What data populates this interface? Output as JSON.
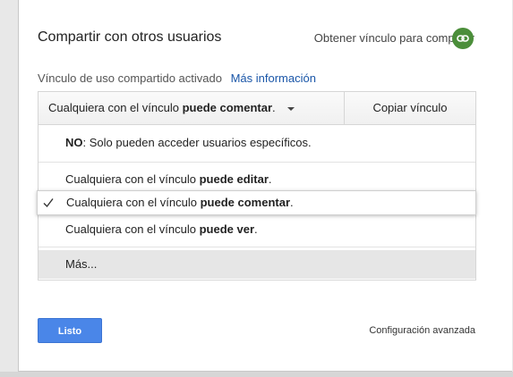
{
  "dialog": {
    "title": "Compartir con otros usuarios",
    "get_link_label": "Obtener vínculo para compartir",
    "get_link_icon": "link-icon",
    "status_text": "Vínculo de uso compartido activado",
    "more_info_label": "Más información",
    "colors": {
      "accent": "#4a86e8",
      "link": "#1a56a8",
      "link_icon_bg": "#4b8e3a"
    }
  },
  "access": {
    "trigger_prefix": "Cualquiera con el vínculo",
    "trigger_bold": "puede comentar",
    "trigger_suffix": ".",
    "copy_label": "Copiar vínculo",
    "options": [
      {
        "bold": "NO",
        "rest": ": Solo pueden acceder usuarios específicos."
      },
      {
        "prefix": "Cualquiera con el vínculo ",
        "bold": "puede editar",
        "suffix": "."
      },
      {
        "prefix": "Cualquiera con el vínculo ",
        "bold": "puede comentar",
        "suffix": ".",
        "selected": true
      },
      {
        "prefix": "Cualquiera con el vínculo ",
        "bold": "puede ver",
        "suffix": "."
      }
    ],
    "more_label": "Más..."
  },
  "footer": {
    "done_label": "Listo",
    "advanced_label": "Configuración avanzada"
  }
}
